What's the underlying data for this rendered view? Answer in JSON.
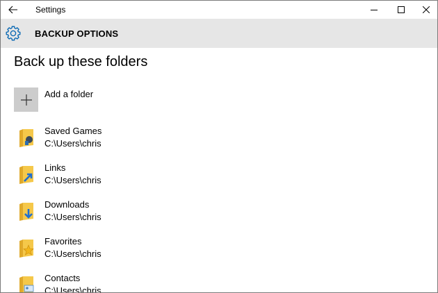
{
  "window": {
    "title": "Settings"
  },
  "header": {
    "title": "BACKUP OPTIONS",
    "icon": "gear-icon"
  },
  "main": {
    "heading": "Back up these folders",
    "add_folder_label": "Add a folder",
    "folders": [
      {
        "name": "Saved Games",
        "path": "C:\\Users\\chris",
        "icon": "saved-games-folder-icon"
      },
      {
        "name": "Links",
        "path": "C:\\Users\\chris",
        "icon": "links-folder-icon"
      },
      {
        "name": "Downloads",
        "path": "C:\\Users\\chris",
        "icon": "downloads-folder-icon"
      },
      {
        "name": "Favorites",
        "path": "C:\\Users\\chris",
        "icon": "favorites-folder-icon"
      },
      {
        "name": "Contacts",
        "path": "C:\\Users\\chris",
        "icon": "contacts-folder-icon"
      }
    ]
  },
  "colors": {
    "header_bg": "#e6e6e6",
    "accent": "#0063b1",
    "folder_yellow": "#f5c84a"
  }
}
